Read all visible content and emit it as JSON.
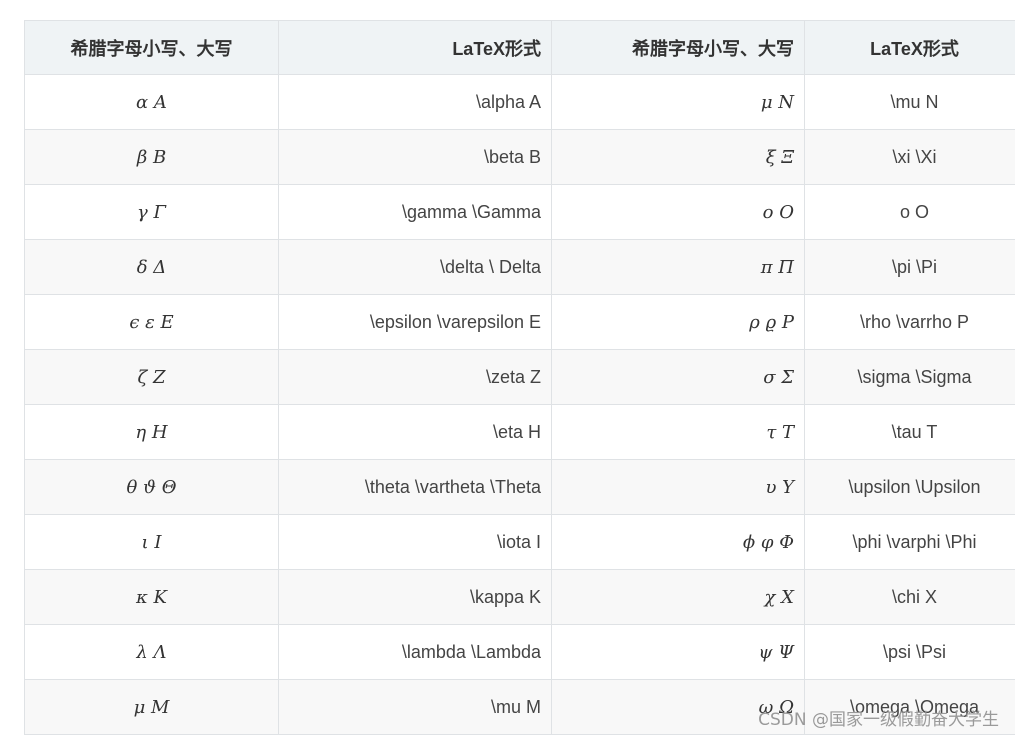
{
  "headers": [
    "希腊字母小写、大写",
    "LaTeX形式",
    "希腊字母小写、大写",
    "LaTeX形式"
  ],
  "rows": [
    {
      "sym1": "α A",
      "latex1": "\\alpha A",
      "sym2": "μ N",
      "latex2": "\\mu N"
    },
    {
      "sym1": "β B",
      "latex1": "\\beta B",
      "sym2": "ξ Ξ",
      "latex2": "\\xi \\Xi"
    },
    {
      "sym1": "γ Γ",
      "latex1": "\\gamma \\Gamma",
      "sym2": "o O",
      "latex2": "o O"
    },
    {
      "sym1": "δ Δ",
      "latex1": "\\delta \\ Delta",
      "sym2": "π Π",
      "latex2": "\\pi \\Pi"
    },
    {
      "sym1": "ϵ ε E",
      "latex1": "\\epsilon \\varepsilon E",
      "sym2": "ρ ϱ P",
      "latex2": "\\rho \\varrho P"
    },
    {
      "sym1": "ζ Z",
      "latex1": "\\zeta Z",
      "sym2": "σ Σ",
      "latex2": "\\sigma \\Sigma"
    },
    {
      "sym1": "η H",
      "latex1": "\\eta H",
      "sym2": "τ T",
      "latex2": "\\tau T"
    },
    {
      "sym1": "θ ϑ Θ",
      "latex1": "\\theta \\vartheta \\Theta",
      "sym2": "υ Υ",
      "latex2": "\\upsilon \\Upsilon"
    },
    {
      "sym1": "ι I",
      "latex1": "\\iota I",
      "sym2": "ϕ φ Φ",
      "latex2": "\\phi \\varphi \\Phi"
    },
    {
      "sym1": "κ K",
      "latex1": "\\kappa K",
      "sym2": "χ X",
      "latex2": "\\chi X"
    },
    {
      "sym1": "λ Λ",
      "latex1": "\\lambda \\Lambda",
      "sym2": "ψ Ψ",
      "latex2": "\\psi \\Psi"
    },
    {
      "sym1": "μ M",
      "latex1": "\\mu M",
      "sym2": "ω Ω",
      "latex2": "\\omega \\Omega"
    }
  ],
  "watermark": "CSDN @国家一级假勤奋大学生"
}
